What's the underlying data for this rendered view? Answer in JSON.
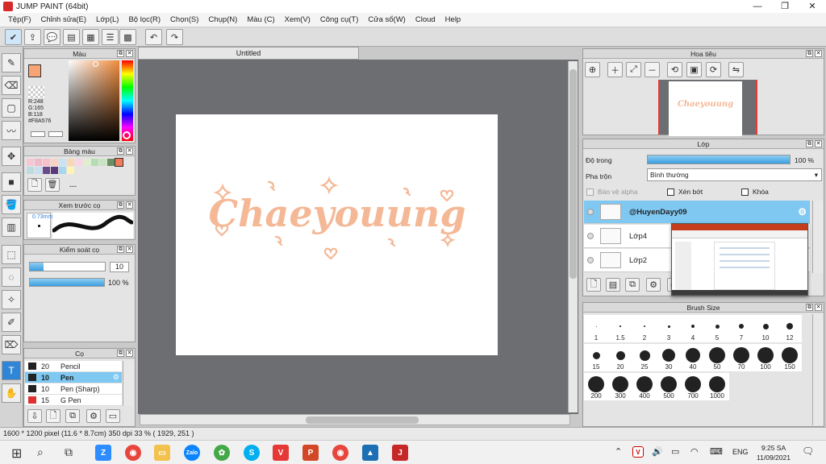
{
  "window": {
    "title": "JUMP PAINT (64bit)"
  },
  "menu": [
    "Tệp(F)",
    "Chỉnh sửa(E)",
    "Lớp(L)",
    "Bộ lọc(R)",
    "Chọn(S)",
    "Chụp(N)",
    "Màu (C)",
    "Xem(V)",
    "Công cụ(T)",
    "Cửa sổ(W)",
    "Cloud",
    "Help"
  ],
  "color_panel": {
    "title": "Màu",
    "r": "R:248",
    "g": "G:165",
    "b": "B:118",
    "hex": "#F8A576",
    "fg_color": "#f8a576"
  },
  "palette_panel": {
    "title": "Bảng màu",
    "extra": "---",
    "swatches": [
      "#f7c6d4",
      "#f3b8c8",
      "#f9c0ca",
      "#fbd1c2",
      "#c7e3f3",
      "#f7d7b5",
      "#fad3e4",
      "#dfeecd",
      "#b6dcb3",
      "#c9e3c3",
      "#6c8e64",
      "#f27b59",
      "#bcdbe0",
      "#c7dff1",
      "#6a4a8a",
      "#5a3a7a",
      "#a6d7ee",
      "#fff4b3"
    ]
  },
  "brush_preview": {
    "title": "Xem trước cọ",
    "size": "0.73mm"
  },
  "brush_control": {
    "title": "Kiểm soát cọ",
    "size": "10",
    "opacity": "100 %"
  },
  "brush_list": {
    "title": "Cọ",
    "items": [
      {
        "size": "20",
        "name": "Pencil",
        "color": "#222"
      },
      {
        "size": "10",
        "name": "Pen",
        "color": "#222"
      },
      {
        "size": "10",
        "name": "Pen (Sharp)",
        "color": "#222"
      },
      {
        "size": "15",
        "name": "G Pen",
        "color": "#e03030"
      }
    ]
  },
  "document": {
    "tab": "Untitled",
    "text": "Chaeyouung",
    "text_color": "#f4b896"
  },
  "navigator": {
    "title": "Hoa tiêu",
    "thumb_text": "Chaeyouung"
  },
  "layers": {
    "title": "Lớp",
    "opacity_label": "Độ trong",
    "opacity_value": "100 %",
    "blend_label": "Pha trộn",
    "blend_value": "Bình thường",
    "protect_alpha": "Bảo vệ alpha",
    "clip": "Xén bớt",
    "lock": "Khóa",
    "rows": [
      {
        "name": "@HuyenDayy09",
        "selected": true
      },
      {
        "name": "Lớp4",
        "selected": false
      },
      {
        "name": "Lớp2",
        "selected": false
      }
    ]
  },
  "brush_size": {
    "title": "Brush Size",
    "sizes": [
      "1",
      "1.5",
      "2",
      "3",
      "4",
      "5",
      "7",
      "10",
      "12",
      "15",
      "20",
      "25",
      "30",
      "40",
      "50",
      "70",
      "100",
      "150",
      "200",
      "300",
      "400",
      "500",
      "700",
      "1000"
    ]
  },
  "status": {
    "text": "1600 * 1200 pixel   (11.6 * 8.7cm)   350 dpi   33 %   ( 1929, 251 )"
  },
  "taskbar": {
    "lang": "ENG",
    "time": "9:25 SA",
    "date": "11/09/2021"
  }
}
